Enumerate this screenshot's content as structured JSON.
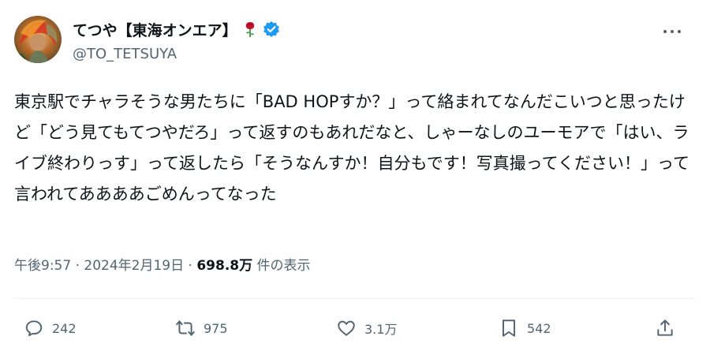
{
  "author": {
    "display_name": "てつや【東海オンエア】",
    "handle": "@TO_TETSUYA",
    "verified": true
  },
  "tweet": {
    "text": "東京駅でチャラそうな男たちに「BAD HOPすか？」って絡まれてなんだこいつと思ったけど「どう見てもてつやだろ」って返すのもあれだなと、しゃーなしのユーモアで「はい、ライブ終わりっす」って返したら「そうなんすか！自分もです！写真撮ってください！」って言われてああああごめんってなった"
  },
  "meta": {
    "time": "午後9:57",
    "separator1": " · ",
    "date": "2024年2月19日",
    "separator2": " · ",
    "views_count": "698.8万",
    "views_label": " 件の表示"
  },
  "actions": {
    "reply_count": "242",
    "retweet_count": "975",
    "like_count": "3.1万",
    "bookmark_count": "542"
  },
  "icons": {
    "reply": "speech-bubble-icon",
    "retweet": "retweet-arrows-icon",
    "like": "heart-icon",
    "bookmark": "bookmark-icon",
    "share": "share-upload-icon",
    "more": "more-dots-icon",
    "verified": "verified-badge-icon",
    "rose": "rose-emoji-icon"
  },
  "colors": {
    "verified_blue": "#1d9bf0",
    "muted_text": "#536471",
    "primary_text": "#0f1419",
    "rose_red": "#c8102e"
  }
}
